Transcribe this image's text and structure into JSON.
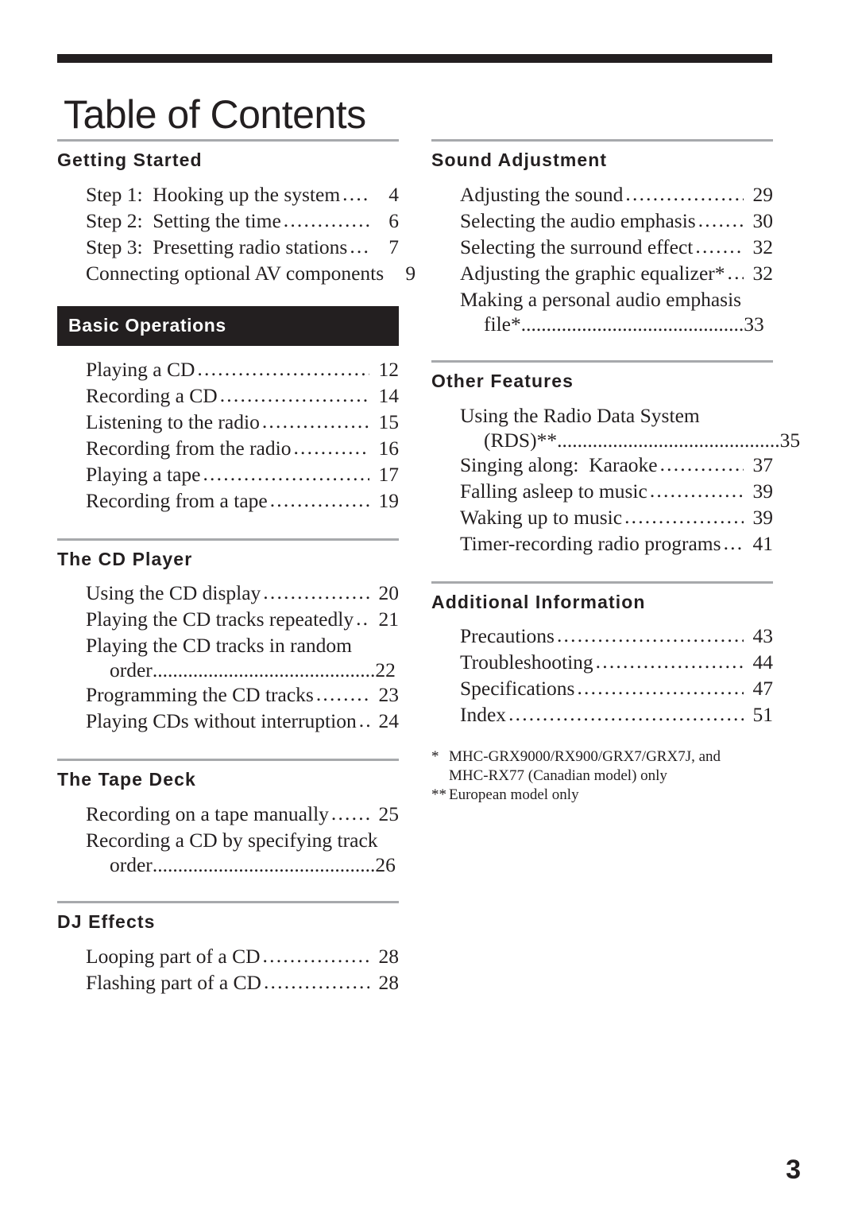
{
  "document": {
    "title": "Table of Contents",
    "folio": "3",
    "accent_color": "#231f20",
    "rule_color": "#a7a9ac"
  },
  "left_column": {
    "sections": [
      {
        "heading": "Getting Started",
        "style": "rule",
        "entries": [
          {
            "label": "Step 1:  Hooking up the system",
            "leader": "............................................",
            "page": "4"
          },
          {
            "label": "Step 2:  Setting the time",
            "leader": "............................................",
            "page": "6"
          },
          {
            "label": "Step 3:  Presetting radio stations",
            "leader": "............................................",
            "page": "7"
          },
          {
            "label": "Connecting optional AV components",
            "leader": "............................................",
            "page": "9"
          }
        ]
      },
      {
        "heading": "Basic Operations",
        "style": "banner",
        "entries": [
          {
            "label": "Playing a CD",
            "leader": "............................................",
            "page": "12"
          },
          {
            "label": "Recording a CD",
            "leader": "............................................",
            "page": "14"
          },
          {
            "label": "Listening to the radio",
            "leader": "............................................",
            "page": "15"
          },
          {
            "label": "Recording from the radio",
            "leader": "............................................",
            "page": "16"
          },
          {
            "label": "Playing a tape",
            "leader": "............................................",
            "page": "17"
          },
          {
            "label": "Recording from a tape",
            "leader": "............................................",
            "page": "19"
          }
        ]
      },
      {
        "heading": "The CD Player",
        "style": "rule",
        "entries": [
          {
            "label": "Using the CD display",
            "leader": "............................................",
            "page": "20"
          },
          {
            "label": "Playing the CD tracks repeatedly",
            "leader": "............................................",
            "page": "21"
          },
          {
            "label": "Playing the CD tracks in random",
            "label2": "order",
            "leader": "............................................",
            "page": "22"
          },
          {
            "label": "Programming the CD tracks",
            "leader": "............................................",
            "page": "23"
          },
          {
            "label": "Playing CDs without interruption",
            "leader": "............................................",
            "page": "24"
          }
        ]
      },
      {
        "heading": "The Tape Deck",
        "style": "rule",
        "entries": [
          {
            "label": "Recording on a tape manually",
            "leader": "............................................",
            "page": "25"
          },
          {
            "label": "Recording a CD by specifying track",
            "label2": "order",
            "leader": "............................................",
            "page": "26"
          }
        ]
      },
      {
        "heading": "DJ Effects",
        "style": "rule",
        "entries": [
          {
            "label": "Looping part of a CD",
            "leader": "............................................",
            "page": "28"
          },
          {
            "label": "Flashing part of a CD",
            "leader": "............................................",
            "page": "28"
          }
        ]
      }
    ]
  },
  "right_column": {
    "sections": [
      {
        "heading": "Sound Adjustment",
        "style": "rule",
        "entries": [
          {
            "label": "Adjusting the sound",
            "leader": "............................................",
            "page": "29"
          },
          {
            "label": "Selecting the audio emphasis",
            "leader": "............................................",
            "page": "30"
          },
          {
            "label": "Selecting the surround effect",
            "leader": "............................................",
            "page": "32"
          },
          {
            "label": "Adjusting the graphic equalizer*",
            "leader": "............................................",
            "page": "32"
          },
          {
            "label": "Making a personal audio emphasis",
            "label2": "file*",
            "leader": "............................................",
            "page": "33"
          }
        ]
      },
      {
        "heading": "Other Features",
        "style": "rule",
        "entries": [
          {
            "label": "Using the Radio Data System",
            "label2": "(RDS)**",
            "leader": "............................................",
            "page": "35"
          },
          {
            "label": "Singing along:  Karaoke",
            "leader": "............................................",
            "page": "37"
          },
          {
            "label": "Falling asleep to music",
            "leader": "............................................",
            "page": "39"
          },
          {
            "label": "Waking up to music",
            "leader": "............................................",
            "page": "39"
          },
          {
            "label": "Timer-recording radio programs",
            "leader": "............................................",
            "page": "41"
          }
        ]
      },
      {
        "heading": "Additional Information",
        "style": "rule",
        "entries": [
          {
            "label": "Precautions",
            "leader": "............................................",
            "page": "43"
          },
          {
            "label": "Troubleshooting",
            "leader": "............................................",
            "page": "44"
          },
          {
            "label": "Specifications",
            "leader": "............................................",
            "page": "47"
          },
          {
            "label": "Index",
            "leader": "............................................",
            "page": "51"
          }
        ]
      }
    ],
    "footnotes": [
      {
        "mark": "*",
        "text": "MHC-GRX9000/RX900/GRX7/GRX7J, and",
        "continuation": "MHC-RX77 (Canadian model) only"
      },
      {
        "mark": "**",
        "text": "European model only",
        "continuation": ""
      }
    ]
  }
}
